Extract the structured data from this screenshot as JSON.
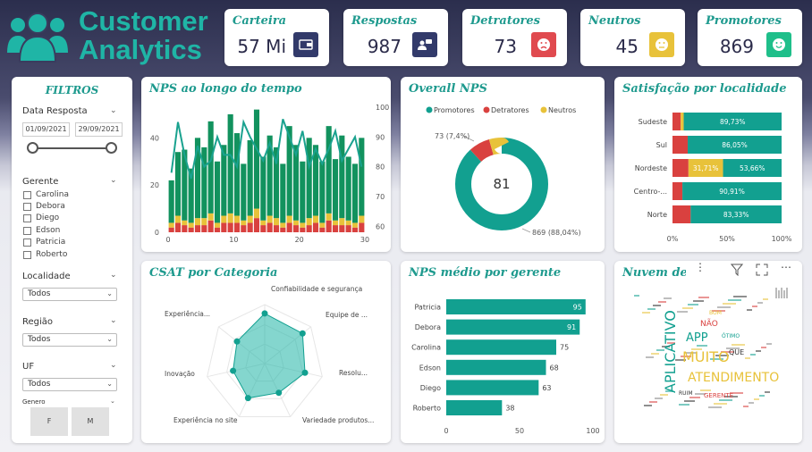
{
  "header": {
    "title_line1": "Customer",
    "title_line2": "Analytics"
  },
  "kpis": [
    {
      "label": "Carteira",
      "value": "57 Mi",
      "icon": "wallet-icon",
      "color": "#323a6a"
    },
    {
      "label": "Respostas",
      "value": "987",
      "icon": "chat-user-icon",
      "color": "#323a6a"
    },
    {
      "label": "Detratores",
      "value": "73",
      "icon": "sad-face-icon",
      "color": "#e04a4f"
    },
    {
      "label": "Neutros",
      "value": "45",
      "icon": "neutral-face-icon",
      "color": "#e8c23a"
    },
    {
      "label": "Promotores",
      "value": "869",
      "icon": "happy-face-icon",
      "color": "#1fbf8a"
    }
  ],
  "filters": {
    "title": "FILTROS",
    "date": {
      "label": "Data Resposta",
      "start": "01/09/2021",
      "end": "29/09/2021"
    },
    "gerente": {
      "label": "Gerente",
      "options": [
        "Carolina",
        "Debora",
        "Diego",
        "Edson",
        "Patricia",
        "Roberto"
      ]
    },
    "localidade": {
      "label": "Localidade",
      "value": "Todos"
    },
    "regiao": {
      "label": "Região",
      "value": "Todos"
    },
    "uf": {
      "label": "UF",
      "value": "Todos"
    },
    "genero": {
      "label": "Genero",
      "options": [
        "F",
        "M"
      ]
    }
  },
  "charts": {
    "nps_time": {
      "title": "NPS ao longo do tempo"
    },
    "overall": {
      "title": "Overall NPS"
    },
    "satisf": {
      "title": "Satisfação por localidade"
    },
    "csat": {
      "title": "CSAT por Categoria"
    },
    "gerente": {
      "title": "NPS médio por gerente"
    },
    "cloud": {
      "title": "Nuvem de comentár"
    }
  },
  "chart_data": [
    {
      "type": "bar",
      "title": "NPS ao longo do tempo",
      "x_ticks": [
        "0",
        "10",
        "20",
        "30"
      ],
      "y_left_ticks": [
        "0",
        "20",
        "40"
      ],
      "y_right_ticks": [
        "60",
        "70",
        "80",
        "90",
        "100"
      ],
      "ylim_left": [
        0,
        53
      ],
      "ylim_right": [
        58,
        100
      ],
      "colors": {
        "Promotores": "#12925e",
        "Detratores": "#d9413f",
        "Neutros": "#e8c23a",
        "line": "#1aa28f"
      },
      "series": [
        {
          "name": "Promotores",
          "values": [
            18,
            27,
            30,
            23,
            34,
            30,
            39,
            26,
            30,
            42,
            35,
            24,
            32,
            42,
            27,
            34,
            30,
            25,
            38,
            32,
            26,
            34,
            30,
            26,
            37,
            26,
            35,
            27,
            25,
            33
          ]
        },
        {
          "name": "Detratores",
          "values": [
            2,
            4,
            3,
            2,
            3,
            3,
            5,
            2,
            4,
            4,
            4,
            3,
            4,
            6,
            3,
            4,
            3,
            2,
            4,
            3,
            2,
            3,
            4,
            2,
            5,
            3,
            3,
            3,
            2,
            4
          ]
        },
        {
          "name": "Neutros",
          "values": [
            2,
            3,
            2,
            2,
            3,
            3,
            3,
            2,
            3,
            4,
            3,
            2,
            3,
            4,
            2,
            3,
            3,
            2,
            3,
            2,
            2,
            3,
            3,
            2,
            3,
            2,
            3,
            2,
            2,
            3
          ]
        }
      ],
      "line": [
        78,
        95,
        84,
        76,
        87,
        80,
        82,
        90,
        84,
        84,
        80,
        95,
        90,
        86,
        82,
        88,
        81,
        96,
        90,
        84,
        92,
        80,
        86,
        81,
        86,
        92,
        82,
        86,
        90,
        80
      ]
    },
    {
      "type": "pie",
      "title": "Overall NPS",
      "center_value": "81",
      "series": [
        {
          "name": "Promotores",
          "value": 869,
          "color": "#12a090",
          "label": "869 (88,04%)"
        },
        {
          "name": "Detratores",
          "value": 73,
          "color": "#d9413f",
          "label": "73 (7,4%)"
        },
        {
          "name": "Neutros",
          "value": 45,
          "color": "#e8c23a",
          "label": ""
        }
      ]
    },
    {
      "type": "bar",
      "title": "Satisfação por localidade",
      "categories": [
        "Sudeste",
        "Sul",
        "Nordeste",
        "Centro-...",
        "Norte"
      ],
      "x_ticks": [
        "0%",
        "50%",
        "100%"
      ],
      "series": [
        {
          "name": "Detratores",
          "color": "#d9413f",
          "values": [
            7.5,
            13.95,
            14.63,
            9.09,
            16.67
          ]
        },
        {
          "name": "Neutros",
          "color": "#e8c23a",
          "values": [
            2.77,
            0,
            31.71,
            0,
            0
          ],
          "labels": [
            "",
            "",
            "31,71%",
            "",
            ""
          ]
        },
        {
          "name": "Promotores",
          "color": "#12a090",
          "values": [
            89.73,
            86.05,
            53.66,
            90.91,
            83.33
          ],
          "labels": [
            "89,73%",
            "86,05%",
            "53,66%",
            "90,91%",
            "83,33%"
          ]
        }
      ]
    },
    {
      "type": "radar",
      "title": "CSAT por Categoria",
      "categories": [
        "Confiabilidade e segurança",
        "Equipe de ...",
        "Resolu...",
        "Variedade produtos...",
        "Experiência no site",
        "Inovação",
        "Experiência..."
      ],
      "values": [
        0.85,
        0.82,
        0.7,
        0.55,
        0.65,
        0.55,
        0.6
      ]
    },
    {
      "type": "bar",
      "title": "NPS médio por gerente",
      "categories": [
        "Patricia",
        "Debora",
        "Carolina",
        "Edson",
        "Diego",
        "Roberto"
      ],
      "values": [
        95,
        91,
        75,
        68,
        63,
        38
      ],
      "x_ticks": [
        "0",
        "50",
        "100"
      ],
      "xlim": [
        0,
        100
      ],
      "color": "#12a090"
    }
  ],
  "wordcloud": [
    {
      "w": "MUITO",
      "c": "#e8c23a",
      "s": 16
    },
    {
      "w": "ATENDIMENTO",
      "c": "#e8c23a",
      "s": 14
    },
    {
      "w": "APLICATIVO",
      "c": "#12a090",
      "s": 16
    },
    {
      "w": "APP",
      "c": "#12a090",
      "s": 13
    },
    {
      "w": "NÃO",
      "c": "#d9413f",
      "s": 9
    },
    {
      "w": "QUE",
      "c": "#333333",
      "s": 8
    },
    {
      "w": "GERENTE",
      "c": "#d9413f",
      "s": 7
    },
    {
      "w": "RUIM",
      "c": "#333333",
      "s": 6
    },
    {
      "w": "ÓTIMO",
      "c": "#12a090",
      "s": 6
    },
    {
      "w": "BOM",
      "c": "#e8c23a",
      "s": 6
    }
  ]
}
